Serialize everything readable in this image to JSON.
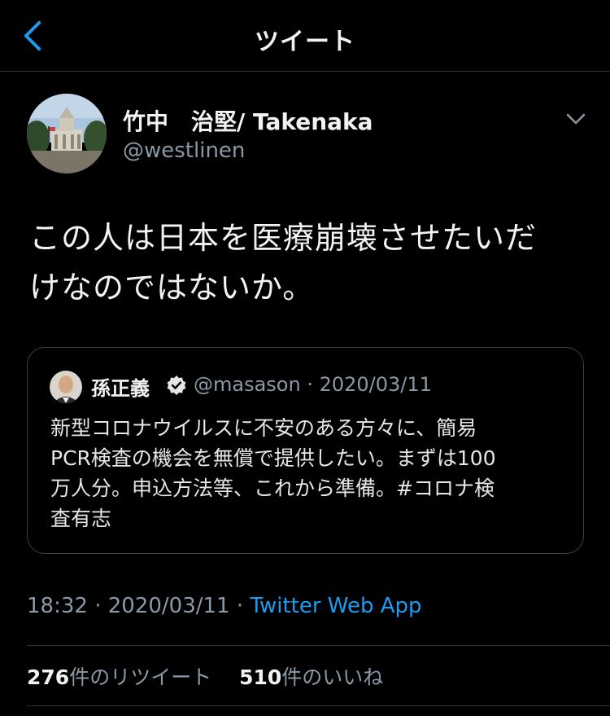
{
  "nav": {
    "title": "ツイート",
    "back_icon": "chevron-left-icon"
  },
  "tweet": {
    "display_name": "竹中　治堅/ Takenaka",
    "handle": "@westlinen",
    "text_line1": "この人は日本を医療崩壊させたいだ",
    "text_line2": "けなのではないか。",
    "menu_icon": "chevron-down-icon"
  },
  "quote": {
    "name": "孫正義",
    "verified_icon": "verified-badge-icon",
    "handle_date": "@masason · 2020/03/11",
    "text_line1": "新型コロナウイルスに不安のある方々に、簡易",
    "text_line2": "PCR検査の機会を無償で提供したい。まずは100",
    "text_line3": "万人分。申込方法等、これから準備。#コロナ検",
    "text_line4": "査有志"
  },
  "meta": {
    "timestamp": "18:32 · 2020/03/11 · ",
    "source": "Twitter Web App"
  },
  "stats": {
    "retweets_count": "276",
    "retweets_label": "件のリツイート",
    "likes_count": "510",
    "likes_label": "件のいいね"
  },
  "colors": {
    "background": "#000000",
    "accent": "#1d9bf0",
    "secondary_text": "#8b98a5",
    "border": "#2f3336"
  }
}
